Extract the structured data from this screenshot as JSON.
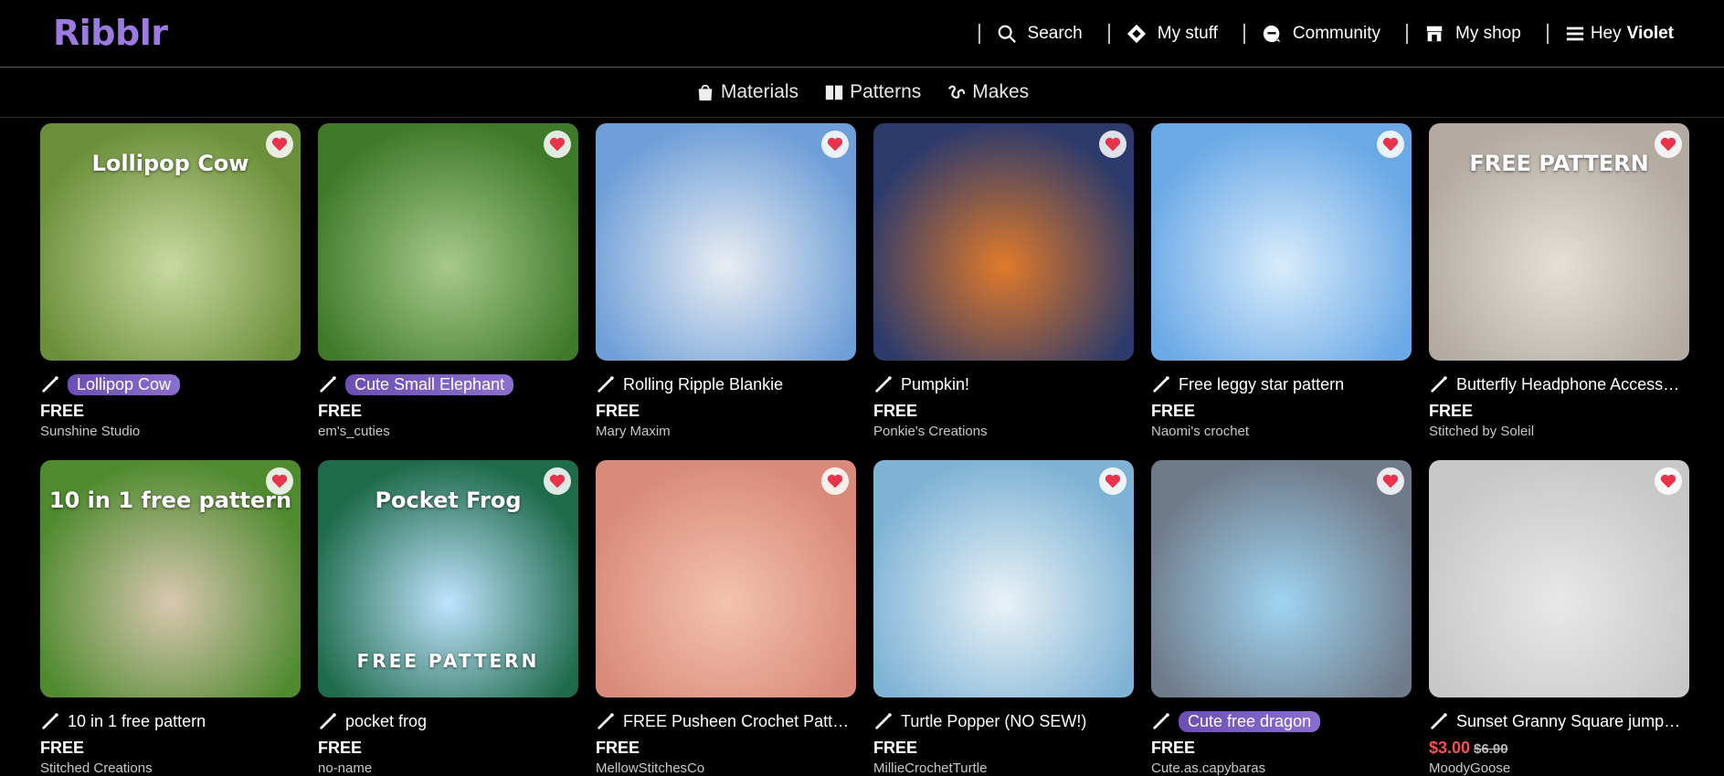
{
  "header": {
    "logo": "Ribblr",
    "nav": [
      {
        "label": "Search",
        "icon": "search-icon"
      },
      {
        "label": "My stuff",
        "icon": "stuff-icon"
      },
      {
        "label": "Community",
        "icon": "chat-icon"
      },
      {
        "label": "My shop",
        "icon": "shop-icon"
      }
    ],
    "greeting": "Hey",
    "user": "Violet"
  },
  "subnav": [
    {
      "label": "Materials",
      "icon": "bag-icon"
    },
    {
      "label": "Patterns",
      "icon": "book-icon"
    },
    {
      "label": "Makes",
      "icon": "yarn-icon"
    }
  ],
  "cards": [
    {
      "title": "Lollipop Cow",
      "highlight": true,
      "price": "FREE",
      "maker": "Sunshine Studio",
      "overlay": "Lollipop Cow",
      "bg": "#6a8f3a",
      "bg2": "#c9d9a0"
    },
    {
      "title": "Cute Small Elephant",
      "highlight": true,
      "price": "FREE",
      "maker": "em's_cuties",
      "overlay": "",
      "bg": "#3f7a2a",
      "bg2": "#a7c98a"
    },
    {
      "title": "Rolling Ripple Blankie",
      "highlight": false,
      "price": "FREE",
      "maker": "Mary Maxim",
      "overlay": "",
      "bg": "#6f9fd8",
      "bg2": "#e9edf2"
    },
    {
      "title": "Pumpkin!",
      "highlight": false,
      "price": "FREE",
      "maker": "Ponkie's Creations",
      "overlay": "",
      "bg": "#2c3a6b",
      "bg2": "#e07a2a"
    },
    {
      "title": "Free leggy star pattern",
      "highlight": false,
      "price": "FREE",
      "maker": "Naomi's crochet",
      "overlay": "",
      "bg": "#6aa8e6",
      "bg2": "#d8ecfb"
    },
    {
      "title": "Butterfly Headphone Accessory",
      "highlight": false,
      "price": "FREE",
      "maker": "Stitched by Soleil",
      "overlay": "FREE PATTERN",
      "bg": "#b3aba2",
      "bg2": "#e5dfd6"
    },
    {
      "title": "10 in 1 free pattern",
      "highlight": false,
      "price": "FREE",
      "maker": "Stitched Creations",
      "overlay": "10 in 1 free pattern",
      "bg": "#4f8a2f",
      "bg2": "#d9c7b0"
    },
    {
      "title": "pocket frog",
      "highlight": false,
      "price": "FREE",
      "maker": "no-name",
      "overlay": "Pocket Frog",
      "bg": "#1e6a4a",
      "bg2": "#bfe3ff"
    },
    {
      "title": "FREE Pusheen Crochet Pattern",
      "highlight": false,
      "price": "FREE",
      "maker": "MellowStitchesCo",
      "overlay": "",
      "bg": "#d98a7a",
      "bg2": "#f4c2b0"
    },
    {
      "title": "Turtle Popper (NO SEW!)",
      "highlight": false,
      "price": "FREE",
      "maker": "MillieCrochetTurtle",
      "overlay": "",
      "bg": "#7fb3d5",
      "bg2": "#e9f2f7"
    },
    {
      "title": "Cute free dragon",
      "highlight": true,
      "price": "FREE",
      "maker": "Cute.as.capybaras",
      "overlay": "",
      "bg": "#6f7a8a",
      "bg2": "#9fd4f0"
    },
    {
      "title": "Sunset Granny Square jumpsuit",
      "highlight": false,
      "price": "",
      "sale_price": "$3.00",
      "orig_price": "$6.00",
      "maker": "MoodyGoose",
      "overlay": "",
      "bg": "#c8c8c8",
      "bg2": "#e8e8e8"
    }
  ],
  "sub_overlays": {
    "frog_free": "FREE PATTERN"
  },
  "colors": {
    "brand": "#9b7be0",
    "highlight": "#7a5fc4",
    "sale": "#ff4d4d",
    "heart": "#e8334b"
  }
}
